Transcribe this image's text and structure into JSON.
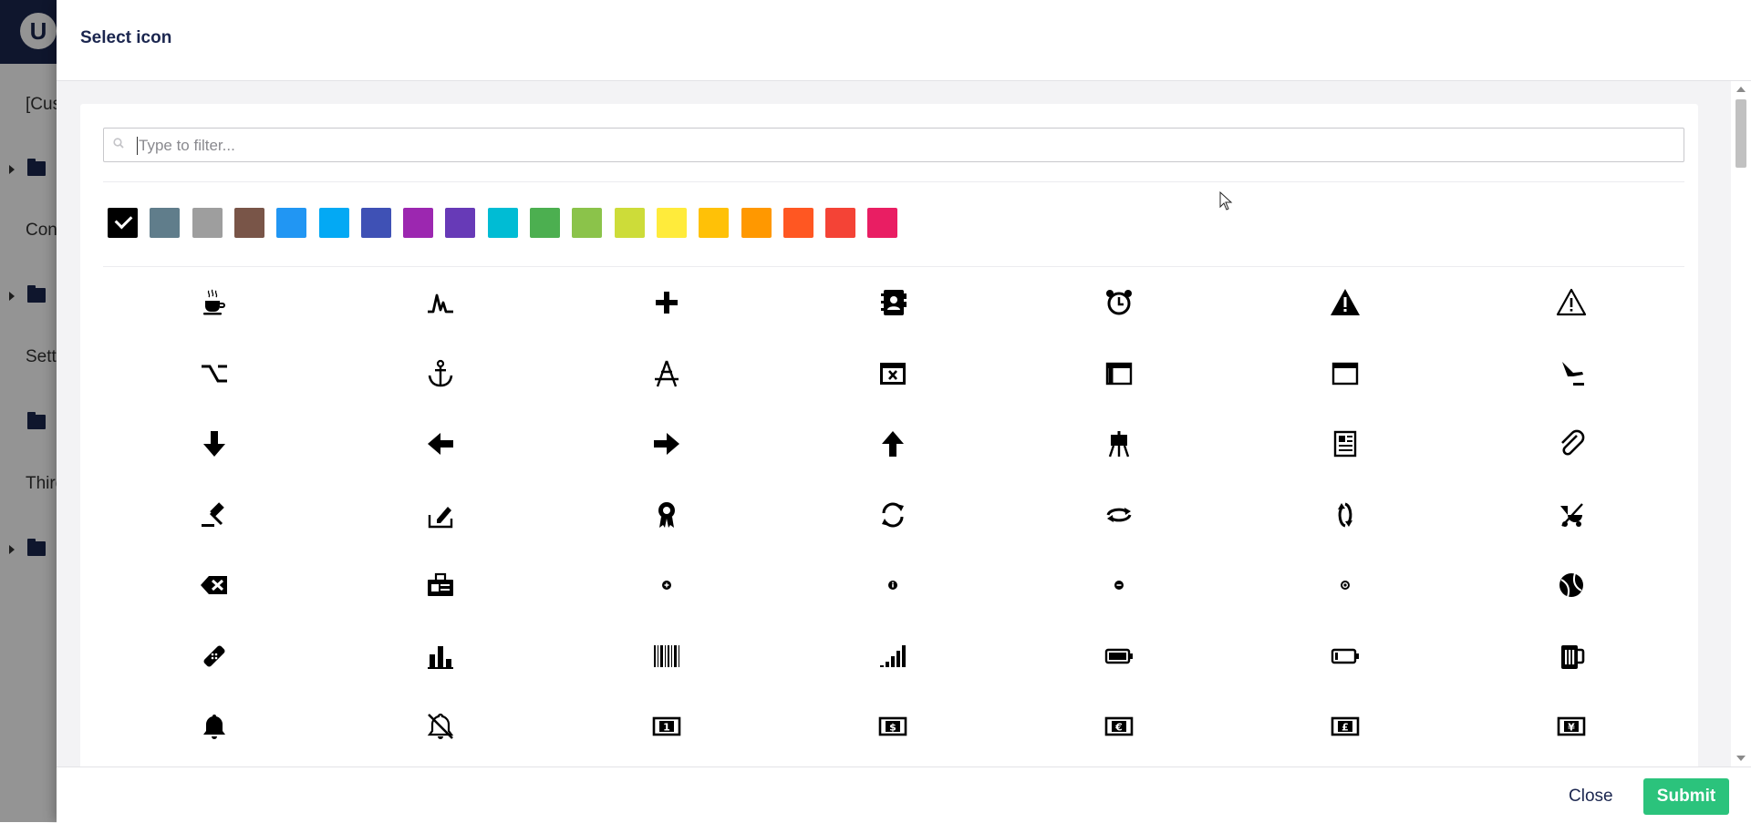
{
  "background": {
    "sections": [
      "[Cus",
      "Cont",
      "Setti",
      "Third"
    ]
  },
  "dialog": {
    "title": "Select icon",
    "filter": {
      "placeholder": "Type to filter...",
      "value": ""
    },
    "colors": [
      {
        "name": "black",
        "hex": "#000000",
        "selected": true
      },
      {
        "name": "blue-grey",
        "hex": "#607d8b"
      },
      {
        "name": "grey",
        "hex": "#9e9e9e"
      },
      {
        "name": "brown",
        "hex": "#795548"
      },
      {
        "name": "blue",
        "hex": "#2196f3"
      },
      {
        "name": "light-blue",
        "hex": "#03a9f4"
      },
      {
        "name": "indigo",
        "hex": "#3f51b5"
      },
      {
        "name": "purple",
        "hex": "#9c27b0"
      },
      {
        "name": "deep-purple",
        "hex": "#673ab7"
      },
      {
        "name": "cyan",
        "hex": "#00bcd4"
      },
      {
        "name": "green",
        "hex": "#4caf50"
      },
      {
        "name": "light-green",
        "hex": "#8bc34a"
      },
      {
        "name": "lime",
        "hex": "#cddc39"
      },
      {
        "name": "yellow",
        "hex": "#ffeb3b"
      },
      {
        "name": "amber",
        "hex": "#ffc107"
      },
      {
        "name": "orange",
        "hex": "#ff9800"
      },
      {
        "name": "deep-orange",
        "hex": "#ff5722"
      },
      {
        "name": "red",
        "hex": "#f44336"
      },
      {
        "name": "pink",
        "hex": "#e91e63"
      }
    ],
    "icons": [
      [
        "coffee",
        "activity",
        "add",
        "address-book",
        "alarm-clock",
        "alert",
        "alert-outline"
      ],
      [
        "alt",
        "anchor",
        "app",
        "application-error",
        "application-window",
        "browser-window",
        "arrival"
      ],
      [
        "arrow-down",
        "arrow-left",
        "arrow-right",
        "arrow-up",
        "art-easel",
        "article",
        "attachment"
      ],
      [
        "auction-hammer",
        "autofill",
        "award",
        "axis-rotation",
        "axis-rotation-2",
        "axis-rotation-3",
        "baby-stroller"
      ],
      [
        "backspace",
        "badge",
        "badge-add",
        "badge-info",
        "badge-remove",
        "badge-stop",
        "ball"
      ],
      [
        "band-aid",
        "bar-chart",
        "barcode",
        "bars",
        "battery-full",
        "battery-low",
        "beer-mug"
      ],
      [
        "bell",
        "bell-off",
        "bill",
        "bill-dollar",
        "bill-euro",
        "bill-pound",
        "bill-yen"
      ]
    ],
    "buttons": {
      "close": "Close",
      "submit": "Submit"
    }
  }
}
